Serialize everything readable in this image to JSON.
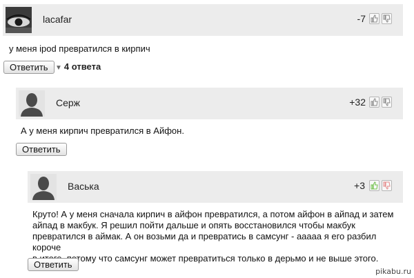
{
  "comments": [
    {
      "author": "lacafar",
      "score": "-7",
      "text": "у меня ipod превратился в кирпич",
      "reply_label": "Ответить",
      "replies_toggle": "4 ответа",
      "avatar": "eye-photo"
    },
    {
      "author": "Серж",
      "score": "+32",
      "text": "А у меня кирпич превратился в Айфон.",
      "reply_label": "Ответить",
      "avatar": "default-silhouette"
    },
    {
      "author": "Васька",
      "score": "+3",
      "lines": [
        "Круто! А у меня сначала кирпич в айфон превратился, а потом айфон в айпад и затем",
        "айпад в макбук. Я решил пойти дальше и опять восстановился чтобы макбук",
        "превратился в аймак. А он возьми да и превратись в самсунг - ааааа я его разбил короче",
        "в итоге, потому что самсунг может превратиться только в дерьмо и не выше этого."
      ],
      "reply_label": "Ответить",
      "avatar": "default-silhouette"
    }
  ],
  "icons": {
    "upvote": "thumbs-up-icon",
    "downvote": "thumbs-down-icon"
  },
  "colors": {
    "header_bg": "#ececec",
    "vote_active_up": "#6fbf4a",
    "vote_active_down": "#e58a8a"
  },
  "watermark": "pikabu.ru"
}
